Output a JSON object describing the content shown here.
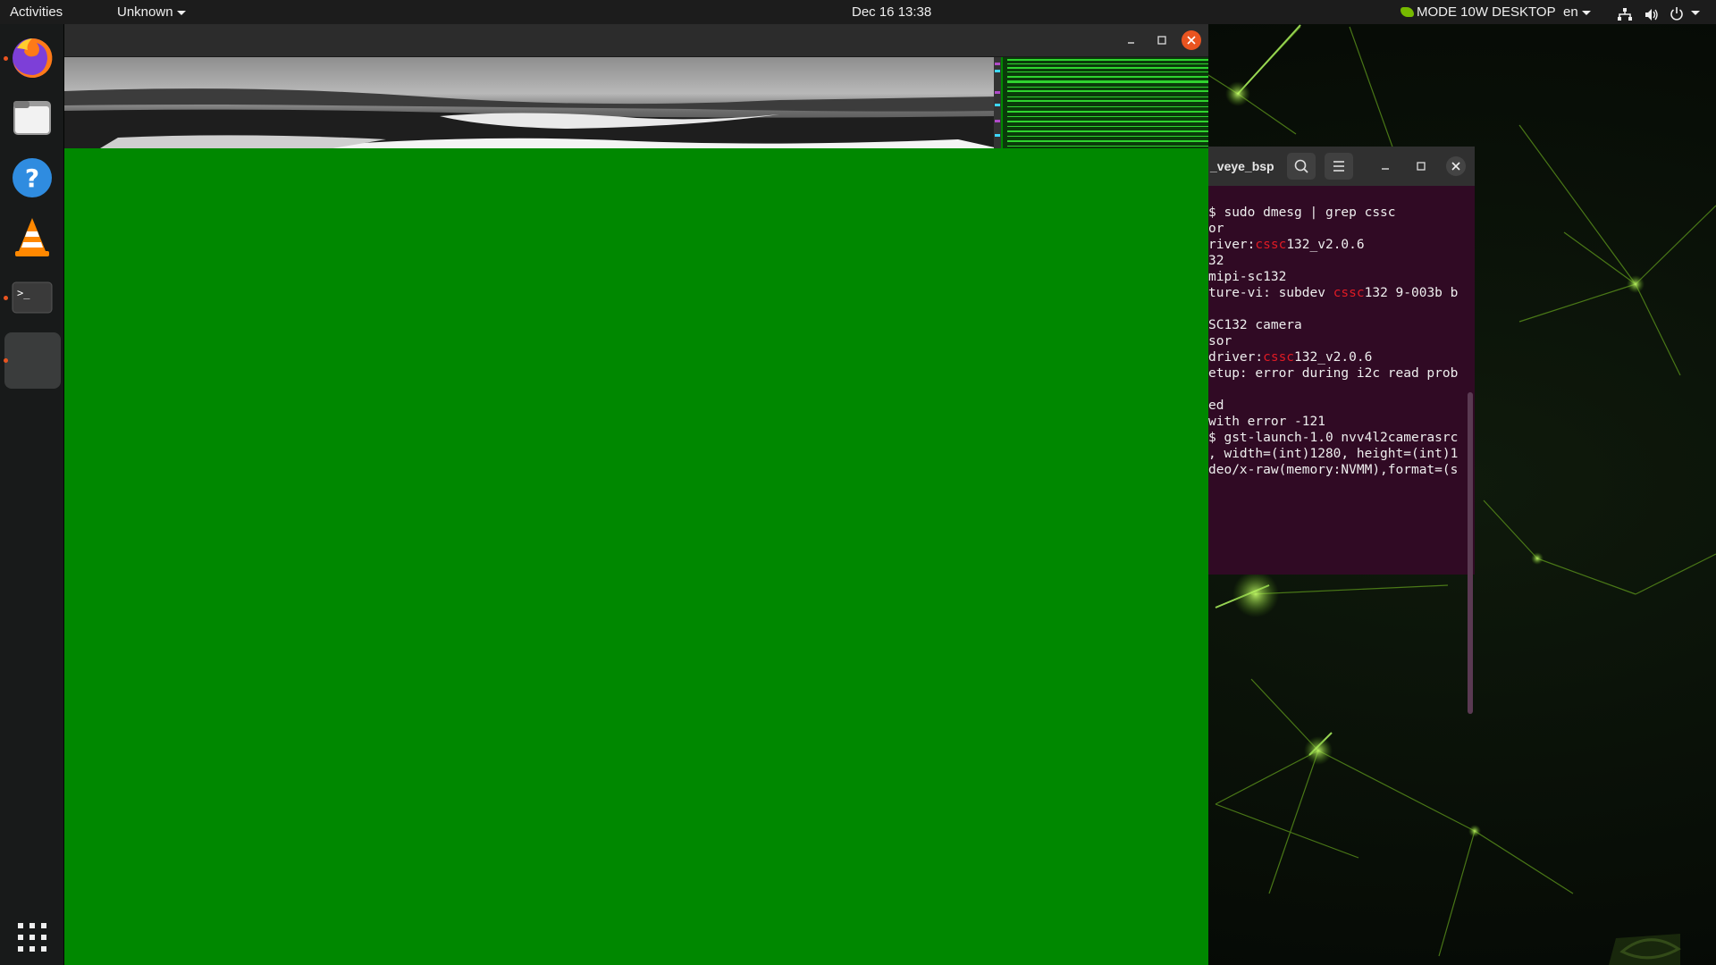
{
  "topbar": {
    "activities": "Activities",
    "app_menu": "Unknown",
    "clock": "Dec 16  13:38",
    "power_mode": "MODE 10W DESKTOP",
    "language": "en"
  },
  "dock": {
    "apps": [
      {
        "name": "Firefox",
        "icon": "firefox-icon",
        "running": true
      },
      {
        "name": "Files",
        "icon": "files-icon",
        "running": false
      },
      {
        "name": "Help",
        "icon": "help-icon",
        "running": false
      },
      {
        "name": "VLC",
        "icon": "vlc-icon",
        "running": false
      },
      {
        "name": "Terminal",
        "icon": "terminal-icon",
        "running": true
      },
      {
        "name": "Active app",
        "icon": "app-icon",
        "running": true
      }
    ],
    "show_apps_icon": "grid-icon"
  },
  "video_window": {
    "title": "",
    "fill_color": "#008800"
  },
  "terminal": {
    "title": "_veye_bsp",
    "lines": [
      {
        "pre": "$ sudo dmesg | grep cssc",
        "hl": "",
        "post": ""
      },
      {
        "pre": "or",
        "hl": "",
        "post": ""
      },
      {
        "pre": "river:",
        "hl": "cssc",
        "post": "132_v2.0.6"
      },
      {
        "pre": "32",
        "hl": "",
        "post": ""
      },
      {
        "pre": "mipi-sc132",
        "hl": "",
        "post": ""
      },
      {
        "pre": "ture-vi: subdev ",
        "hl": "cssc",
        "post": "132 9-003b b"
      },
      {
        "pre": "",
        "hl": "",
        "post": ""
      },
      {
        "pre": "SC132 camera",
        "hl": "",
        "post": ""
      },
      {
        "pre": "sor",
        "hl": "",
        "post": ""
      },
      {
        "pre": "driver:",
        "hl": "cssc",
        "post": "132_v2.0.6"
      },
      {
        "pre": "etup: error during i2c read prob",
        "hl": "",
        "post": ""
      },
      {
        "pre": "",
        "hl": "",
        "post": ""
      },
      {
        "pre": "ed",
        "hl": "",
        "post": ""
      },
      {
        "pre": "with error -121",
        "hl": "",
        "post": ""
      },
      {
        "pre": "$ gst-launch-1.0 nvv4l2camerasrc",
        "hl": "",
        "post": ""
      },
      {
        "pre": ", width=(int)1280, height=(int)1",
        "hl": "",
        "post": ""
      },
      {
        "pre": "deo/x-raw(memory:NVMM),format=(s",
        "hl": "",
        "post": ""
      }
    ]
  }
}
